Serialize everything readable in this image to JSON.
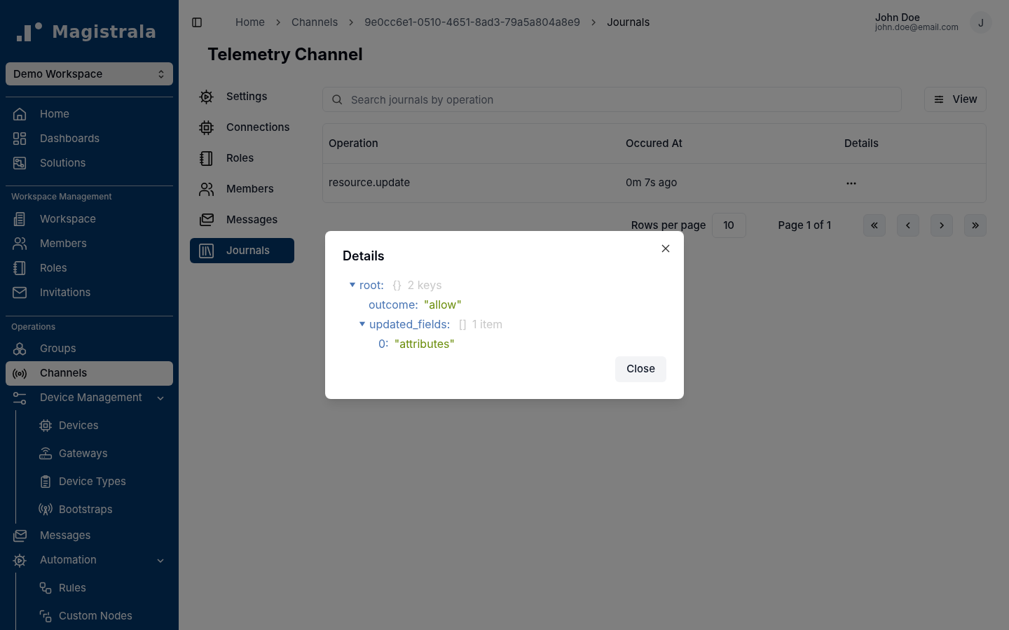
{
  "sidebar": {
    "brand": "Magistrala",
    "workspace": "Demo Workspace",
    "sections": [
      {
        "items": [
          {
            "label": "Home",
            "selected": false
          },
          {
            "label": "Dashboards",
            "selected": false
          },
          {
            "label": "Solutions",
            "selected": false
          }
        ]
      },
      {
        "title": "Workspace Management",
        "items": [
          {
            "label": "Workspace",
            "selected": false
          },
          {
            "label": "Members",
            "selected": false
          },
          {
            "label": "Roles",
            "selected": false
          },
          {
            "label": "Invitations",
            "selected": false
          }
        ]
      },
      {
        "title": "Operations",
        "items": [
          {
            "label": "Groups",
            "selected": false
          },
          {
            "label": "Channels",
            "selected": true
          },
          {
            "label": "Device Management",
            "selected": false,
            "expanded": true,
            "children": [
              {
                "label": "Devices",
                "selected": false
              },
              {
                "label": "Gateways",
                "selected": false
              },
              {
                "label": "Device Types",
                "selected": false
              },
              {
                "label": "Bootstraps",
                "selected": false
              }
            ]
          },
          {
            "label": "Messages",
            "selected": false
          },
          {
            "label": "Automation",
            "selected": false,
            "expanded": true,
            "children": [
              {
                "label": "Rules",
                "selected": false
              },
              {
                "label": "Custom Nodes",
                "selected": false
              }
            ]
          }
        ]
      }
    ]
  },
  "header": {
    "breadcrumbs": [
      "Home",
      "Channels",
      "9e0cc6e1-0510-4651-8ad3-79a5a804a8e9",
      "Journals"
    ],
    "user": {
      "name": "John Doe",
      "email": "john.doe@email.com",
      "initial": "J"
    }
  },
  "page_title": "Telemetry Channel",
  "tabs": [
    {
      "label": "Settings",
      "selected": false
    },
    {
      "label": "Connections",
      "selected": false
    },
    {
      "label": "Roles",
      "selected": false
    },
    {
      "label": "Members",
      "selected": false
    },
    {
      "label": "Messages",
      "selected": false
    },
    {
      "label": "Journals",
      "selected": true
    }
  ],
  "search": {
    "placeholder": "Search journals by operation"
  },
  "view_button": "View",
  "table": {
    "columns": [
      "Operation",
      "Occured At",
      "Details"
    ],
    "rows": [
      {
        "cells": [
          "resource.update",
          "0m 7s ago"
        ]
      }
    ]
  },
  "pagination": {
    "rows_label": "Rows per page",
    "rows_value": "10",
    "page_label": "Page 1 of 1"
  },
  "modal": {
    "title": "Details",
    "button": "Close",
    "tree": [
      {
        "key": "root:",
        "bracket": "{}",
        "meta": "2 keys",
        "expanded": true,
        "children": [
          {
            "key": "outcome:",
            "value": "\"allow\""
          },
          {
            "key": "updated_fields:",
            "bracket": "[]",
            "meta": "1 item",
            "expanded": true,
            "children": [
              {
                "key": "0:",
                "value": "\"attributes\""
              }
            ]
          }
        ]
      }
    ]
  }
}
